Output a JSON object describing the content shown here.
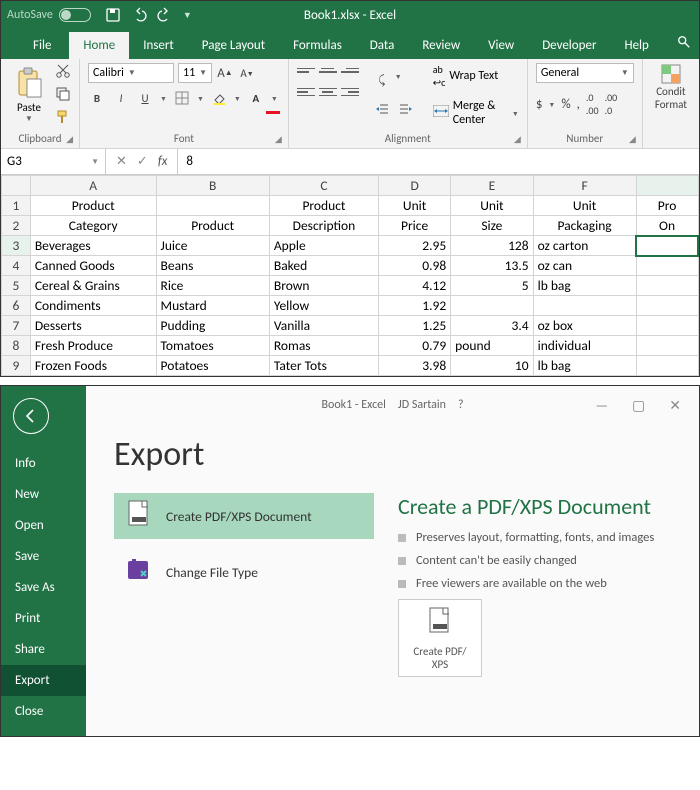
{
  "top": {
    "autosave": "AutoSave",
    "title": "Book1.xlsx - Excel",
    "tabs": [
      "File",
      "Home",
      "Insert",
      "Page Layout",
      "Formulas",
      "Data",
      "Review",
      "View",
      "Developer",
      "Help"
    ],
    "active_tab": "Home",
    "ribbon": {
      "clipboard": {
        "paste": "Paste",
        "label": "Clipboard"
      },
      "font": {
        "name": "Calibri",
        "size": "11",
        "label": "Font"
      },
      "alignment": {
        "wrap": "Wrap Text",
        "merge": "Merge & Center",
        "label": "Alignment"
      },
      "number": {
        "format": "General",
        "label": "Number"
      },
      "cond": {
        "line1": "Condit",
        "line2": "Format"
      }
    },
    "namebox": "G3",
    "formula": "8",
    "columns": [
      "",
      "A",
      "B",
      "C",
      "D",
      "E",
      "F",
      ""
    ],
    "header1": [
      "1",
      "Product",
      "",
      "Product",
      "Unit",
      "Unit",
      "Unit",
      "Pro"
    ],
    "header2": [
      "2",
      "Category",
      "Product",
      "Description",
      "Price",
      "Size",
      "Packaging",
      "On"
    ],
    "rows": [
      [
        "3",
        "Beverages",
        "Juice",
        "Apple",
        "2.95",
        "128",
        "oz carton",
        ""
      ],
      [
        "4",
        "Canned Goods",
        "Beans",
        "Baked",
        "0.98",
        "13.5",
        "oz can",
        ""
      ],
      [
        "5",
        "Cereal & Grains",
        "Rice",
        "Brown",
        "4.12",
        "5",
        "lb bag",
        ""
      ],
      [
        "6",
        "Condiments",
        "Mustard",
        "Yellow",
        "1.92",
        "",
        "",
        ""
      ],
      [
        "7",
        "Desserts",
        "Pudding",
        "Vanilla",
        "1.25",
        "3.4",
        "oz box",
        ""
      ],
      [
        "8",
        "Fresh Produce",
        "Tomatoes",
        "Romas",
        "0.79",
        "pound",
        "individual",
        ""
      ],
      [
        "9",
        "Frozen Foods",
        "Potatoes",
        "Tater Tots",
        "3.98",
        "10",
        "lb bag",
        ""
      ]
    ]
  },
  "bottom": {
    "title": "Book1  -  Excel",
    "user": "JD Sartain",
    "side": [
      "Info",
      "New",
      "Open",
      "Save",
      "Save As",
      "Print",
      "Share",
      "Export",
      "Close"
    ],
    "active_side": "Export",
    "heading": "Export",
    "options": [
      {
        "label": "Create PDF/XPS Document",
        "active": true
      },
      {
        "label": "Change File Type",
        "active": false
      }
    ],
    "right": {
      "heading": "Create a PDF/XPS Document",
      "bullets": [
        "Preserves layout, formatting, fonts, and images",
        "Content can't be easily changed",
        "Free viewers are available on the web"
      ],
      "button": "Create PDF/\nXPS"
    }
  }
}
